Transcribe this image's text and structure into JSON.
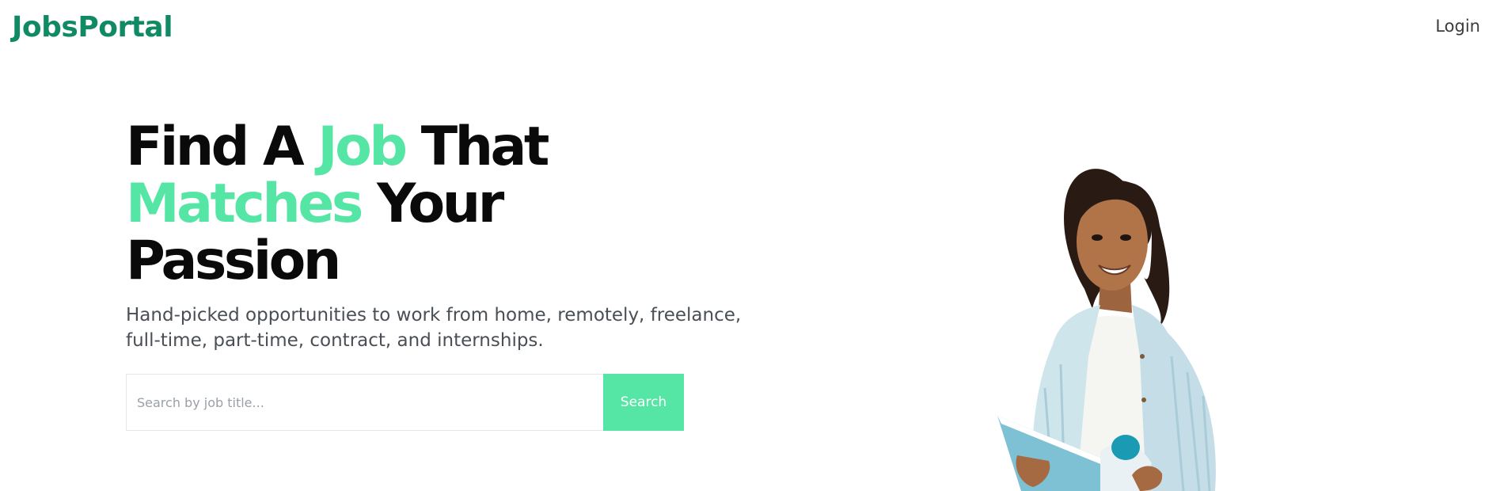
{
  "header": {
    "logo": "JobsPortal",
    "login": "Login"
  },
  "hero": {
    "headline": {
      "w1": "Find A",
      "w2": "Job",
      "w3": "That",
      "w4": "Matches",
      "w5": "Your",
      "w6": "Passion"
    },
    "subtitle_line1": "Hand-picked opportunities to work from home, remotely, freelance,",
    "subtitle_line2": "full-time, part-time, contract, and internships.",
    "search": {
      "placeholder": "Search by job title...",
      "button": "Search"
    }
  },
  "colors": {
    "brand": "#108a64",
    "accent": "#55e6a5",
    "text": "#0a0a0a",
    "muted": "#4a4f55"
  }
}
